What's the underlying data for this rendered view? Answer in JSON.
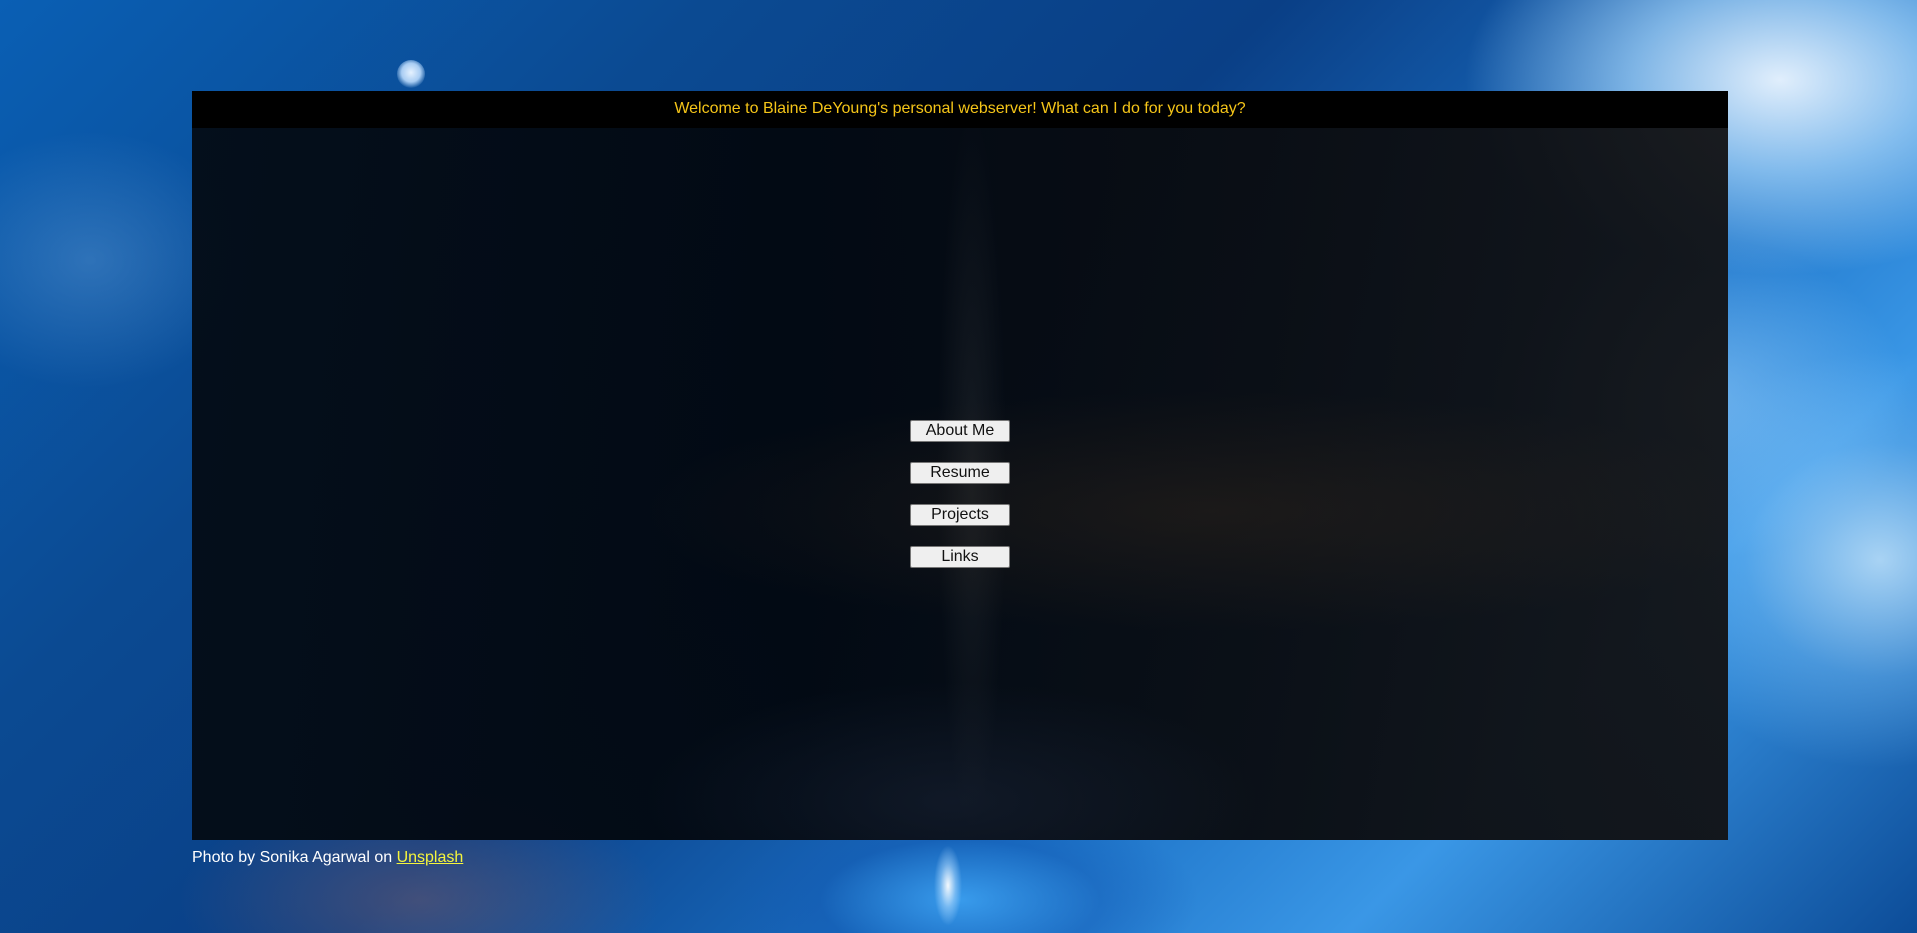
{
  "header": {
    "welcome_text": "Welcome to Blaine DeYoung's personal webserver! What can I do for you today?"
  },
  "nav": {
    "buttons": [
      {
        "label": "About Me"
      },
      {
        "label": "Resume"
      },
      {
        "label": "Projects"
      },
      {
        "label": "Links"
      }
    ]
  },
  "footer": {
    "credit_prefix": "Photo by Sonika Agarwal on ",
    "credit_link": "Unsplash"
  },
  "colors": {
    "header_text": "#f5c518",
    "header_background": "#000000",
    "link": "#f5f53c"
  }
}
